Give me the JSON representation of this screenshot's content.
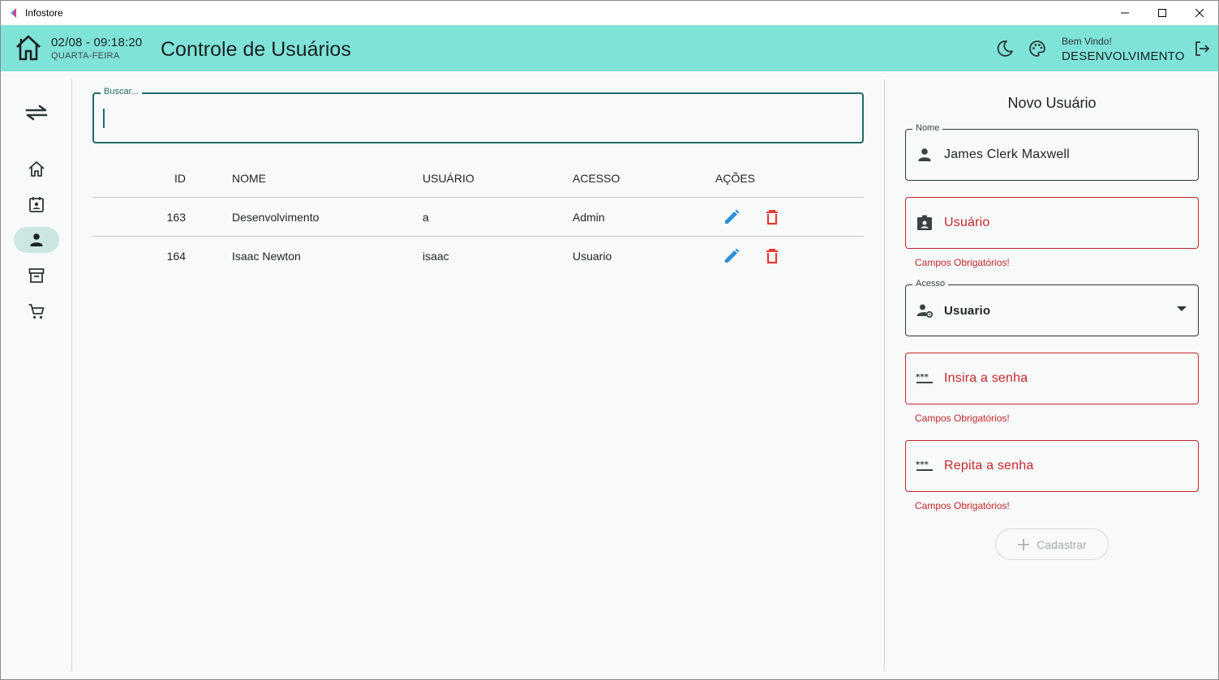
{
  "window": {
    "title": "Infostore"
  },
  "header": {
    "date_time": "02/08 - 09:18:20",
    "weekday": "QUARTA-FEIRA",
    "page_title": "Controle de Usuários",
    "welcome_label": "Bem Vindo!",
    "username": "DESENVOLVIMENTO"
  },
  "sidebar": {
    "items": [
      {
        "icon": "home-icon",
        "active": false
      },
      {
        "icon": "contact-calendar-icon",
        "active": false
      },
      {
        "icon": "person-icon",
        "active": true
      },
      {
        "icon": "archive-icon",
        "active": false
      },
      {
        "icon": "cart-icon",
        "active": false
      }
    ]
  },
  "search": {
    "label": "Buscar...",
    "value": ""
  },
  "table": {
    "headers": {
      "id": "ID",
      "nome": "NOME",
      "usuario": "USUÁRIO",
      "acesso": "ACESSO",
      "acoes": "AÇÕES"
    },
    "rows": [
      {
        "id": "163",
        "nome": "Desenvolvimento",
        "usuario": "a",
        "acesso": "Admin"
      },
      {
        "id": "164",
        "nome": "Isaac Newton",
        "usuario": "isaac",
        "acesso": "Usuario"
      }
    ]
  },
  "form": {
    "title": "Novo Usuário",
    "nome": {
      "label": "Nome",
      "value": "James Clerk Maxwell"
    },
    "usuario": {
      "placeholder": "Usuário",
      "error": "Campos Obrigatórios!"
    },
    "acesso": {
      "label": "Acesso",
      "value": "Usuario"
    },
    "senha": {
      "placeholder": "Insira a senha",
      "error": "Campos Obrigatórios!"
    },
    "repetir_senha": {
      "placeholder": "Repita a senha",
      "error": "Campos Obrigatórios!"
    },
    "submit_label": "Cadastrar"
  },
  "colors": {
    "header_bg": "#7fe3d8",
    "accent": "#1f6b66",
    "error": "#c4272b",
    "edit": "#2a8fd8",
    "delete": "#e53935"
  }
}
